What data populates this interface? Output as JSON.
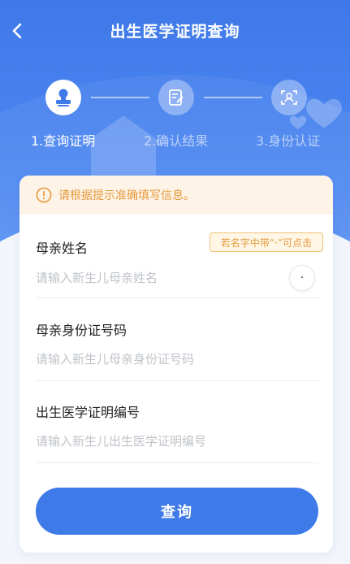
{
  "nav": {
    "title": "出生医学证明查询"
  },
  "steps": [
    {
      "label": "1.查询证明",
      "active": true
    },
    {
      "label": "2.确认结果",
      "active": false
    },
    {
      "label": "3.身份认证",
      "active": false
    }
  ],
  "notice": {
    "text": "请根据提示准确填写信息。"
  },
  "form": {
    "mother_name": {
      "label": "母亲姓名",
      "placeholder": "请输入新生儿母亲姓名",
      "value": ""
    },
    "mother_name_tip": "若名字中带“·”可点击",
    "dot_button": "·",
    "mother_id": {
      "label": "母亲身份证号码",
      "placeholder": "请输入新生儿母亲身份证号码",
      "value": ""
    },
    "birth_cert": {
      "label": "出生医学证明编号",
      "placeholder": "请输入新生儿出生医学证明编号",
      "value": ""
    }
  },
  "submit_label": "查询",
  "colors": {
    "primary": "#3f7ae9",
    "notice_bg": "#fdf3e7",
    "notice_text": "#e79b3c"
  }
}
